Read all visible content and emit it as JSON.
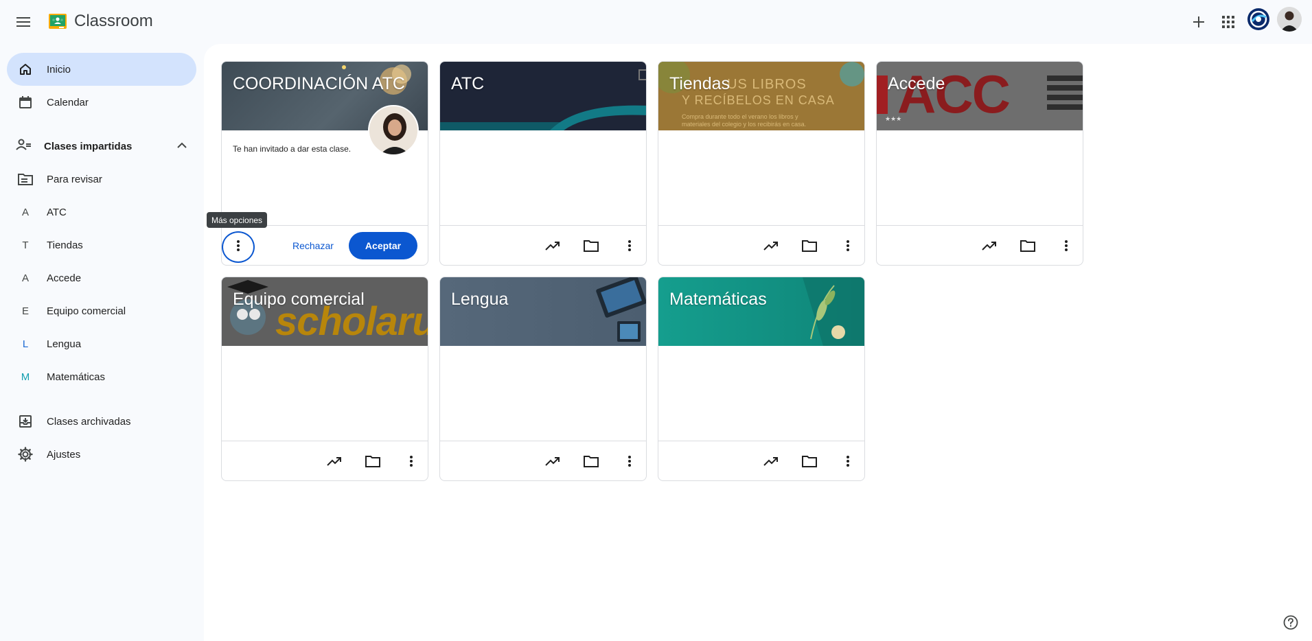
{
  "app": {
    "title": "Classroom"
  },
  "sidebar": {
    "items": [
      {
        "label": "Inicio"
      },
      {
        "label": "Calendar"
      }
    ],
    "teaching_section": {
      "label": "Clases impartidas",
      "to_review": "Para revisar",
      "classes": [
        {
          "letter": "A",
          "label": "ATC",
          "color": "#444746"
        },
        {
          "letter": "T",
          "label": "Tiendas",
          "color": "#444746"
        },
        {
          "letter": "A",
          "label": "Accede",
          "color": "#444746"
        },
        {
          "letter": "E",
          "label": "Equipo comercial",
          "color": "#444746"
        },
        {
          "letter": "L",
          "label": "Lengua",
          "color": "#1967d2"
        },
        {
          "letter": "M",
          "label": "Matemáticas",
          "color": "#129eaf"
        }
      ]
    },
    "archived": "Clases archivadas",
    "settings": "Ajustes"
  },
  "cards": [
    {
      "title": "COORDINACIÓN ATC",
      "invite_text": "Te han invitado a dar esta clase.",
      "decline": "Rechazar",
      "accept": "Aceptar",
      "theme": "dark-slate"
    },
    {
      "title": "ATC",
      "theme": "navy-teal"
    },
    {
      "title": "Tiendas",
      "theme": "orange",
      "banner_heading_1": "US LIBROS",
      "banner_heading_2": "Y RECÍBELOS EN CASA",
      "banner_sub_1": "Compra durante todo el verano los libros y",
      "banner_sub_2": "materiales del colegio y los recibirás en casa."
    },
    {
      "title": "Accede",
      "theme": "red-black",
      "banner_text": "ACC"
    },
    {
      "title": "Equipo comercial",
      "theme": "scholar",
      "banner_text": "scholaru"
    },
    {
      "title": "Lengua",
      "theme": "blue-grey"
    },
    {
      "title": "Matemáticas",
      "theme": "teal"
    }
  ],
  "tooltip": {
    "text": "Más opciones"
  },
  "colors": {
    "accent": "#0b57d0",
    "active_nav": "#d3e3fd"
  }
}
